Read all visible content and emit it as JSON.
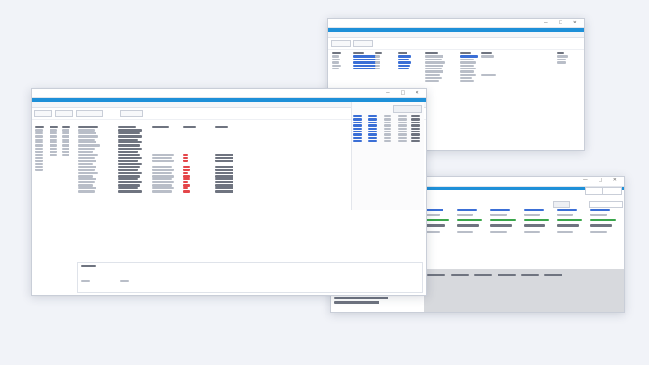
{
  "windows": {
    "main": {
      "toolbar": {
        "buttons": [
          "",
          "",
          "",
          ""
        ]
      }
    },
    "top_right": {
      "toolbar": {
        "buttons": [
          "",
          ""
        ]
      }
    },
    "bottom_right": {
      "header_buttons": [
        "",
        ""
      ],
      "cards": [
        {
          "date": "",
          "green": "",
          "line1": "",
          "line2": ""
        },
        {
          "date": "",
          "green": "",
          "line1": "",
          "line2": ""
        },
        {
          "date": "",
          "green": "",
          "line1": "",
          "line2": ""
        },
        {
          "date": "",
          "green": "",
          "line1": "",
          "line2": ""
        },
        {
          "date": "",
          "green": "",
          "line1": "",
          "line2": ""
        },
        {
          "date": "",
          "green": "",
          "line1": "",
          "line2": ""
        }
      ],
      "footer": [
        "",
        ""
      ]
    }
  }
}
